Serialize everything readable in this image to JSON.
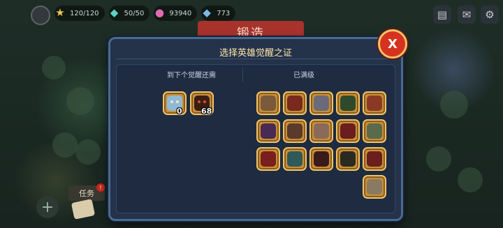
{
  "topbar": {
    "energy": "120/120",
    "tickets": "50/50",
    "gold": "93940",
    "other": "773"
  },
  "banner": {
    "title": "锻造"
  },
  "modal": {
    "title": "选择英雄觉醒之证",
    "close_label": "X",
    "left_label": "到下个觉醒还需",
    "right_label": "已满级",
    "needs": [
      {
        "icon": "hero-frost-icon",
        "count": "0"
      },
      {
        "icon": "hero-dark-rider-icon",
        "count": "68"
      }
    ],
    "maxed_count": 16
  },
  "hud": {
    "task_label": "任务",
    "task_badge": "!"
  },
  "colors": {
    "panel": "#24324a",
    "panel_border": "#4a6b8e",
    "close_button": "#d6321f",
    "title_text": "#ffe9a8",
    "hero_frame": "#c6903a"
  }
}
